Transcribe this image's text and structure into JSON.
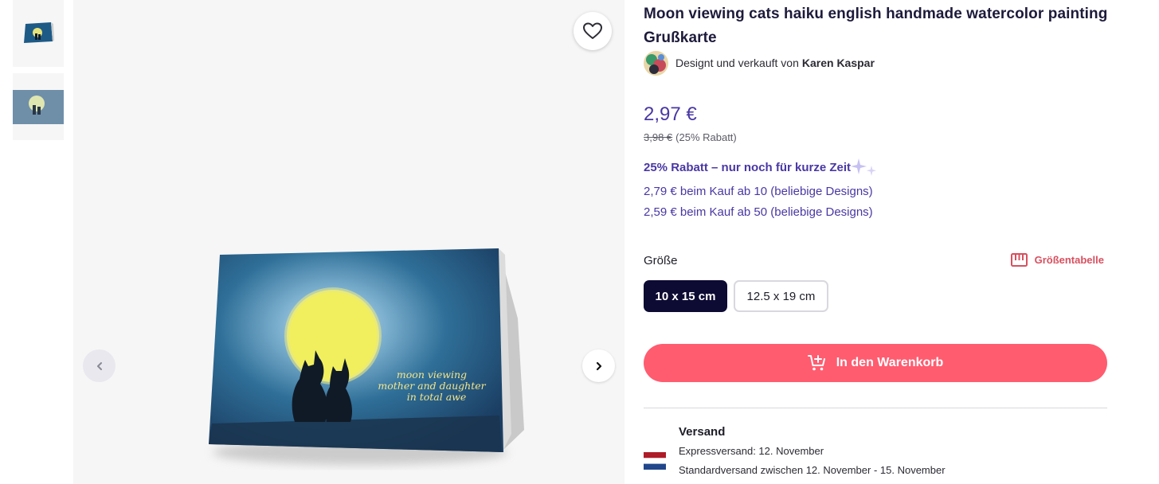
{
  "product": {
    "title": "Moon viewing cats haiku english handmade watercolor painting Grußkarte",
    "designer_prefix": "Designt und verkauft von",
    "designer_name": "Karen Kaspar"
  },
  "pricing": {
    "price": "2,97 €",
    "old_price": "3,98 €",
    "discount_note": "(25% Rabatt)",
    "promo": "25% Rabatt – nur noch für kurze Zeit",
    "tiers": [
      "2,79 € beim Kauf ab 10 (beliebige Designs)",
      "2,59 € beim Kauf ab 50 (beliebige Designs)"
    ],
    "accent_color": "#4a37a4"
  },
  "size": {
    "label": "Größe",
    "chart_link": "Größentabelle",
    "options": [
      "10 x 15 cm",
      "12.5 x 19 cm"
    ],
    "selected": "10 x 15 cm"
  },
  "cart": {
    "button_label": "In den Warenkorb",
    "color": "#ff5c70"
  },
  "shipping": {
    "title": "Versand",
    "express": "Expressversand: 12. November",
    "standard": "Standardversand zwischen 12. November - 15. November"
  },
  "artwork": {
    "haiku": [
      "moon viewing",
      "mother and daughter",
      "in total awe"
    ]
  },
  "icons": {
    "favorite": "heart-icon",
    "prev": "chevron-left-icon",
    "next": "chevron-right-icon",
    "size_chart": "ruler-icon",
    "cart": "cart-plus-icon",
    "sparkle": "sparkle-icon",
    "flag": "netherlands-flag-icon"
  }
}
